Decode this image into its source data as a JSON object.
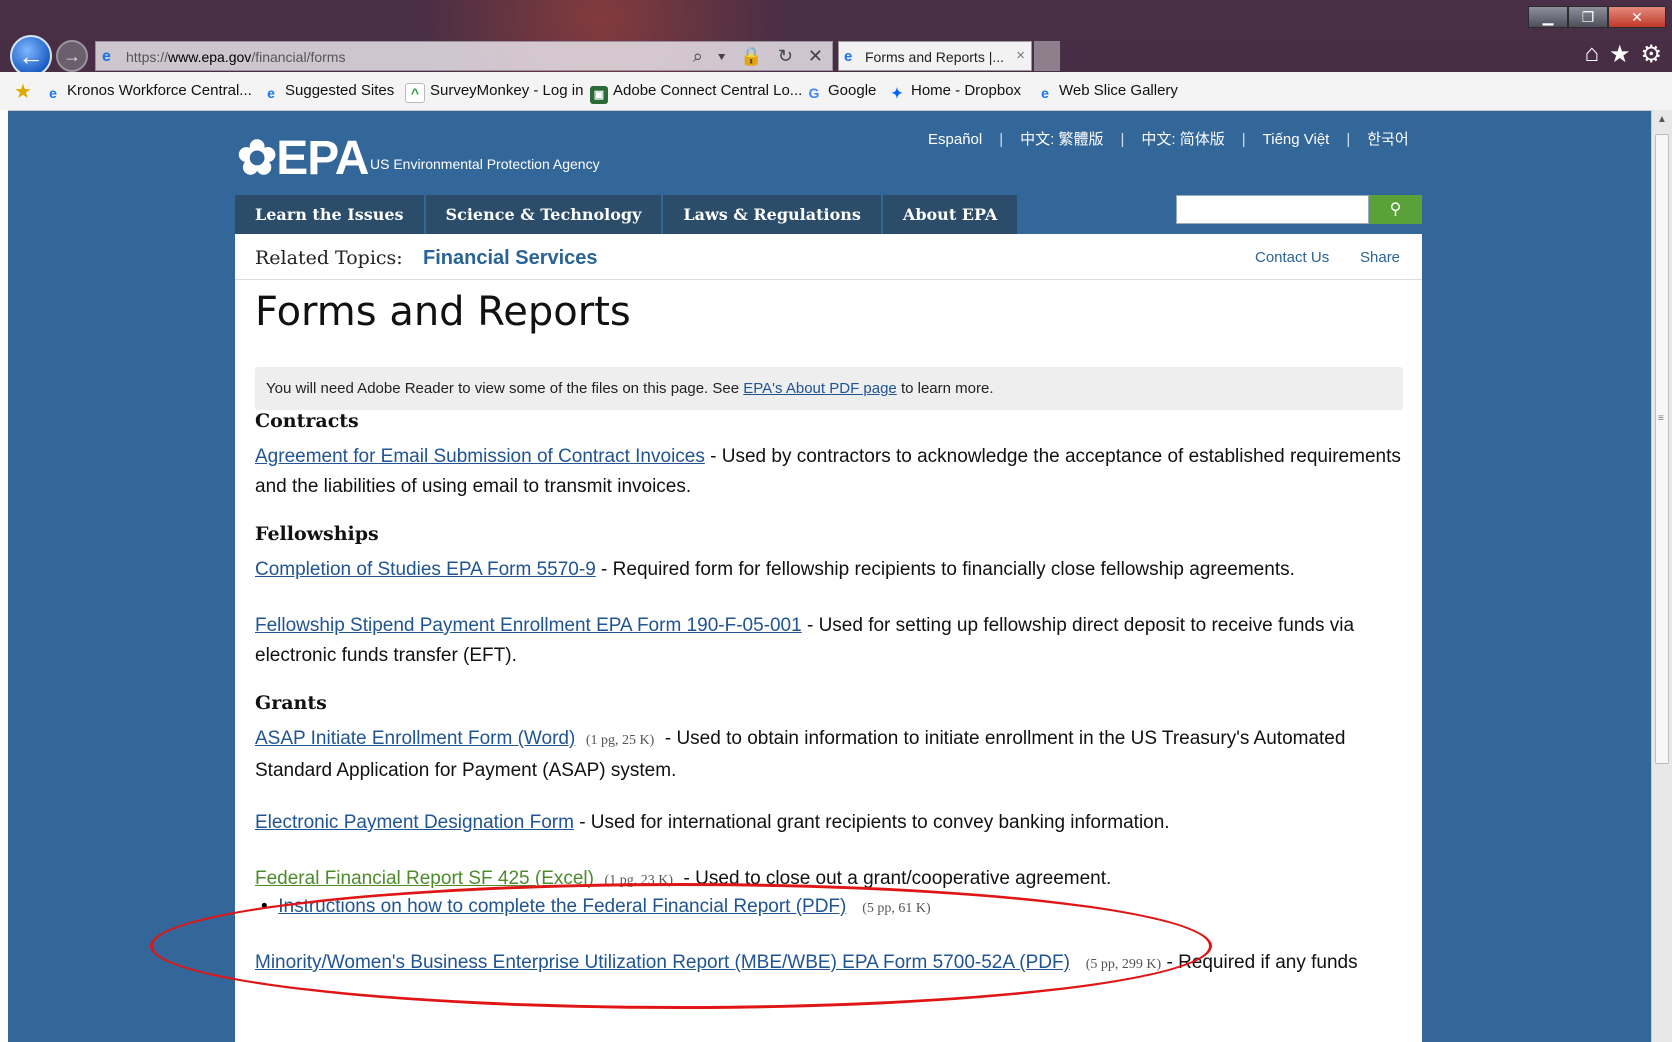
{
  "browser": {
    "address_prefix": "https://",
    "address_domain": "www.epa.gov",
    "address_path": "/financial/forms",
    "address_tools": "⌕ ▾ 🔒 ↻ ✕",
    "tab_title": "Forms and Reports |...",
    "window_controls": {
      "minimize": "▁",
      "restore": "❐",
      "close": "✕"
    },
    "toolbar_icons": {
      "home": "⌂",
      "favorites": "★",
      "tools": "⚙"
    },
    "favorites": [
      {
        "label": "Kronos Workforce Central...",
        "icon": "ie-icon"
      },
      {
        "label": "Suggested Sites",
        "icon": "ie-icon"
      },
      {
        "label": "SurveyMonkey - Log in",
        "icon": "surveymonkey-icon"
      },
      {
        "label": "Adobe Connect Central Lo...",
        "icon": "adobe-connect-icon"
      },
      {
        "label": "Google",
        "icon": "google-icon"
      },
      {
        "label": "Home - Dropbox",
        "icon": "dropbox-icon"
      },
      {
        "label": "Web Slice Gallery",
        "icon": "ie-icon"
      }
    ]
  },
  "header": {
    "logo_text": "EPA",
    "agency_name": "US Environmental Protection Agency",
    "languages": [
      "Español",
      "中文: 繁體版",
      "中文: 简体版",
      "Tiếng Việt",
      "한국어"
    ]
  },
  "nav": {
    "items": [
      "Learn the Issues",
      "Science & Technology",
      "Laws & Regulations",
      "About EPA"
    ],
    "search_placeholder": "",
    "search_icon": "search-icon"
  },
  "related": {
    "label": "Related Topics:",
    "topic": "Financial Services",
    "contact": "Contact Us",
    "share": "Share"
  },
  "page": {
    "title": "Forms and Reports",
    "notice_before": "You will need Adobe Reader to view some of the files on this page. See ",
    "notice_link": "EPA's About PDF page",
    "notice_after": " to learn more."
  },
  "sections": {
    "contracts": {
      "heading": "Contracts",
      "items": [
        {
          "link": "Agreement for Email Submission of Contract Invoices",
          "desc": " - Used by contractors to acknowledge the acceptance of established requirements and the liabilities of using email to transmit invoices."
        }
      ]
    },
    "fellowships": {
      "heading": "Fellowships",
      "items": [
        {
          "link": "Completion of Studies EPA Form 5570-9",
          "desc": " - Required form for fellowship recipients to financially close fellowship agreements."
        },
        {
          "link": "Fellowship Stipend Payment Enrollment EPA Form 190-F-05-001",
          "desc": " - Used for setting up fellowship direct deposit to receive funds via electronic funds transfer (EFT)."
        }
      ]
    },
    "grants": {
      "heading": "Grants",
      "items": [
        {
          "link": "ASAP Initiate Enrollment Form (Word)",
          "meta": "(1 pg, 25 K)",
          "desc": " - Used to obtain information to initiate enrollment in the US Treasury's Automated Standard Application for Payment (ASAP) system."
        },
        {
          "link": "Electronic Payment Designation Form",
          "desc": " - Used for international grant recipients to convey banking information."
        },
        {
          "link": "Federal Financial Report SF 425 (Excel)",
          "meta": "(1 pg, 23 K)",
          "desc": " - Used to close out a grant/cooperative agreement.",
          "sub_link": "Instructions on how to complete the Federal Financial Report (PDF)",
          "sub_meta": "(5 pp, 61 K)"
        },
        {
          "link": "Minority/Women's Business Enterprise Utilization Report (MBE/WBE) EPA Form 5700-52A (PDF)",
          "meta": "(5 pp, 299 K)",
          "desc": " - Required if any funds"
        }
      ]
    }
  },
  "colors": {
    "page_bg": "#336699",
    "nav_bg": "#2b4d6a",
    "link": "#205493",
    "visited_link": "#4c8c2b",
    "search_btn": "#5aa13a",
    "annotation": "#e01515"
  }
}
